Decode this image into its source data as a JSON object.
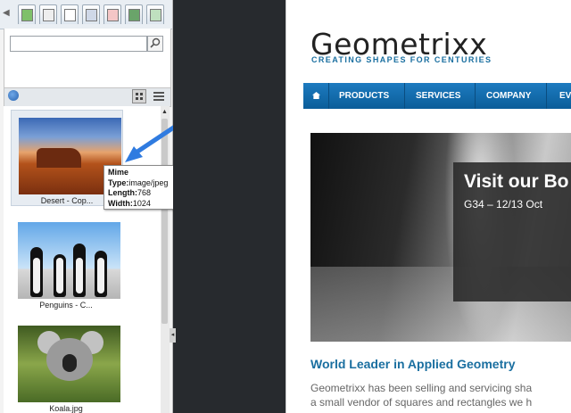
{
  "finder": {
    "search": {
      "value": "",
      "placeholder": ""
    },
    "items": [
      {
        "caption": "Desert - Cop...",
        "image": "desert"
      },
      {
        "caption": "Penguins - C...",
        "image": "penguins"
      },
      {
        "caption": "Koala.jpg",
        "image": "koala"
      }
    ],
    "tooltip": {
      "heading": "Mime",
      "lines": [
        {
          "key": "Type:",
          "value": "image/jpeg"
        },
        {
          "key": "Length:",
          "value": "768"
        },
        {
          "key": "Width:",
          "value": "1024"
        }
      ]
    }
  },
  "site": {
    "logo": "Geometrixx",
    "tagline": "CREATING SHAPES FOR CENTURIES",
    "nav": [
      "PRODUCTS",
      "SERVICES",
      "COMPANY",
      "EV"
    ],
    "promo": {
      "title": "Visit our Bo",
      "subtitle": "G34 – 12/13 Oct"
    },
    "headline": "World Leader in Applied Geometry",
    "body_lines": [
      "Geometrixx has been selling and servicing sha",
      "a small vendor of squares and rectangles we h"
    ]
  },
  "colors": {
    "accent": "#1a6fa0",
    "nav": "#0b5d99",
    "annotation_arrow": "#2f7be0"
  }
}
